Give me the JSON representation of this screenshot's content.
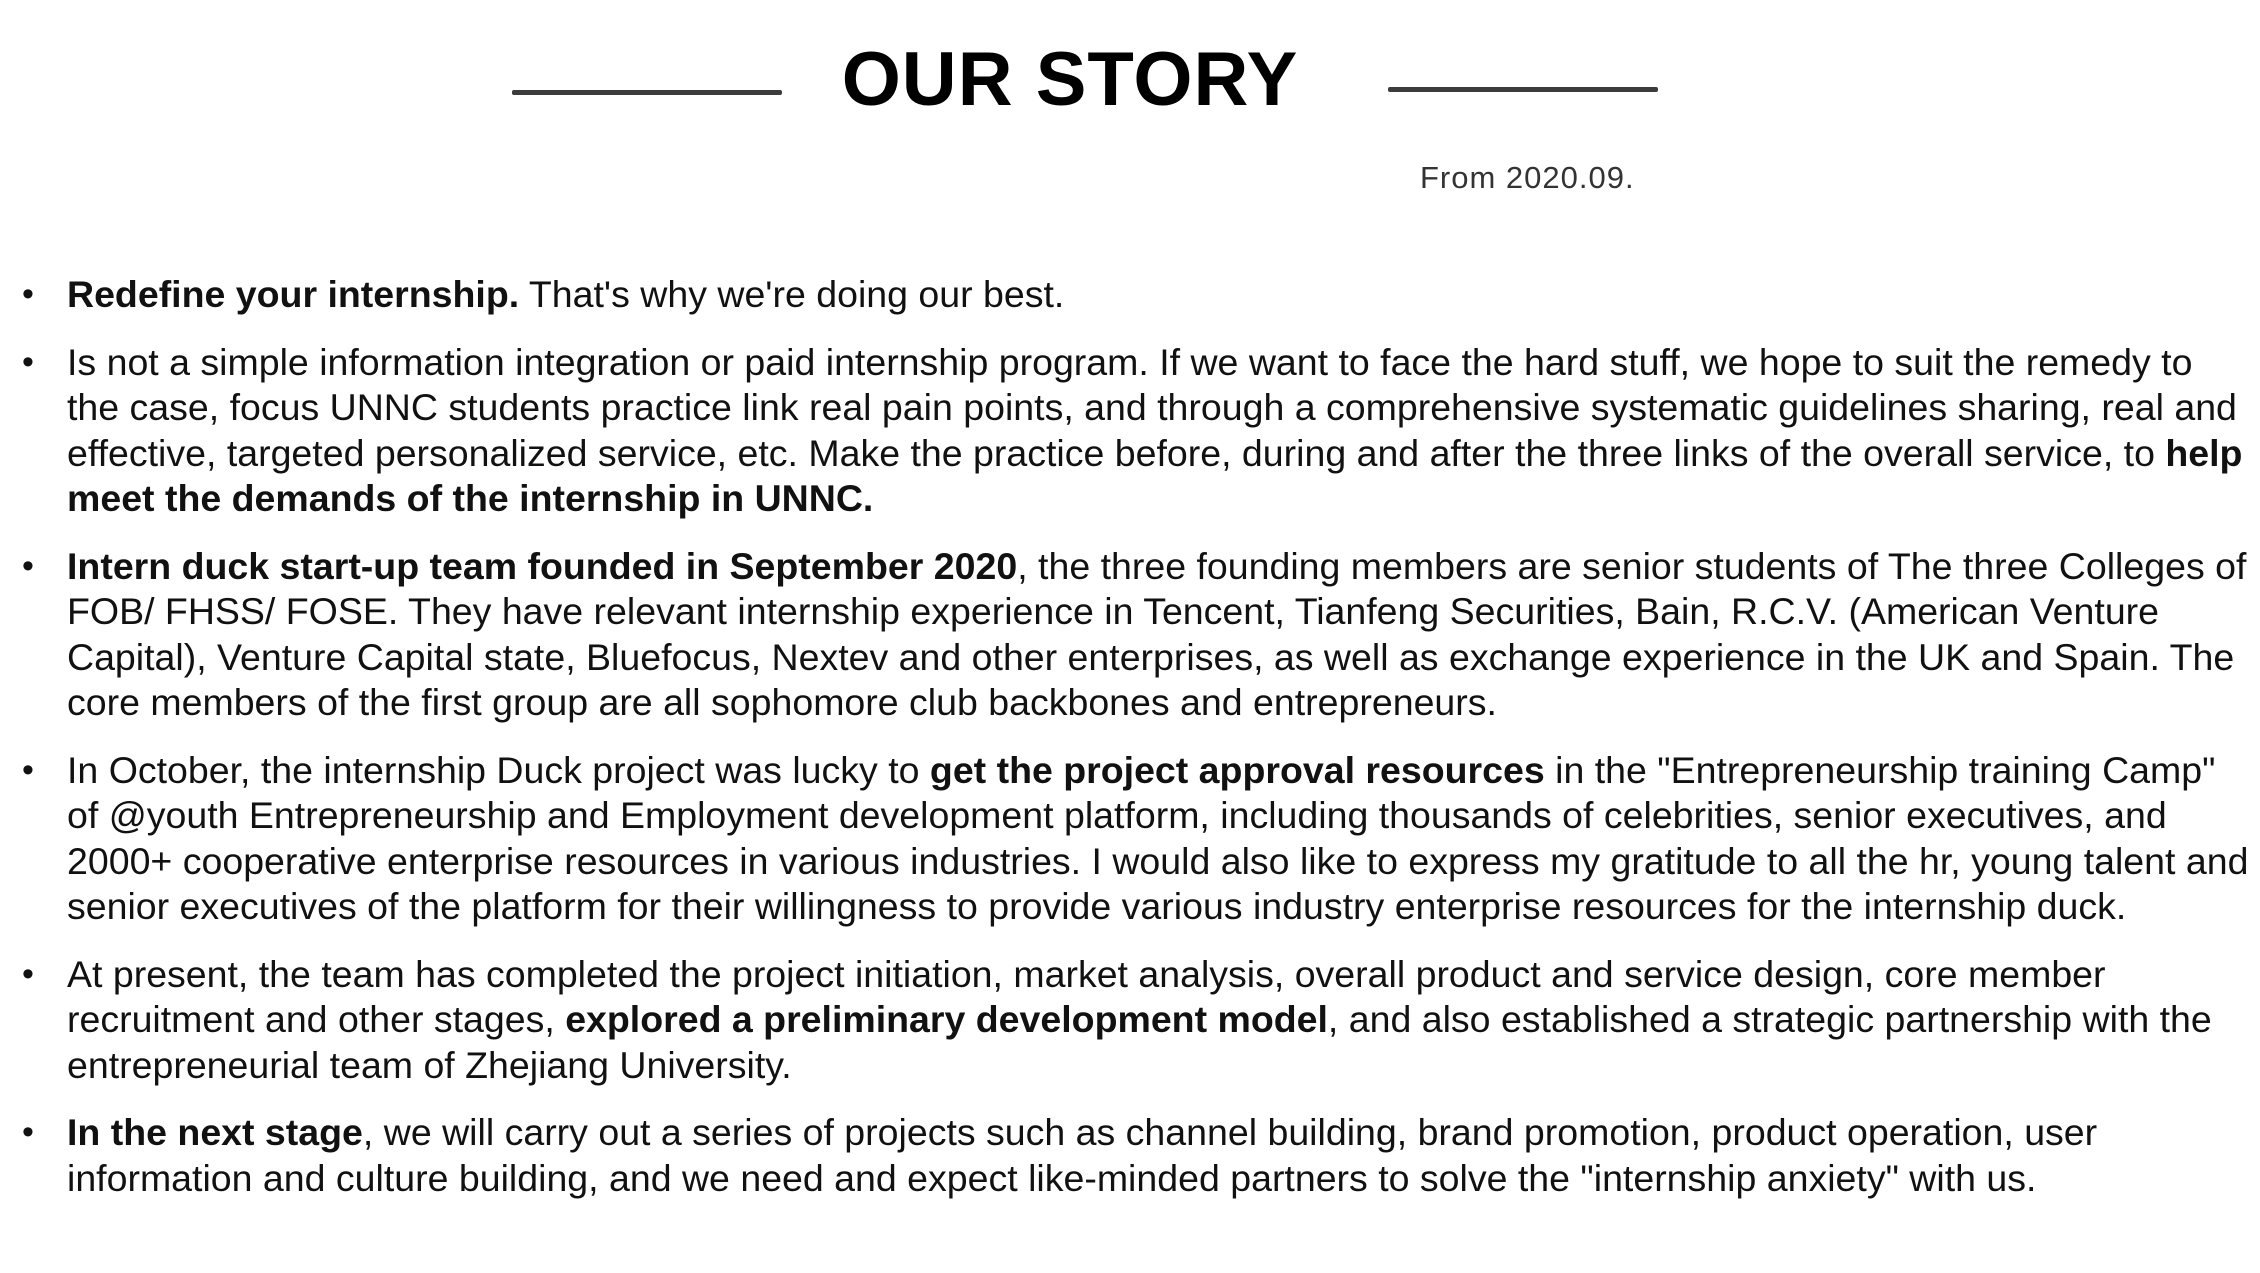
{
  "header": {
    "title": "OUR STORY",
    "subtitle": "From 2020.09."
  },
  "bullets": [
    {
      "segments": [
        {
          "text": "Redefine your internship.",
          "bold": true
        },
        {
          "text": " That's why we're doing our best.",
          "bold": false
        }
      ]
    },
    {
      "segments": [
        {
          "text": "Is not a simple information integration or paid internship program. If we want to face the hard stuff, we hope to suit the remedy to the case, focus UNNC students practice link real pain points, and through a comprehensive systematic guidelines sharing, real and effective, targeted personalized service, etc. Make the practice before, during and after the three links of the overall service, to ",
          "bold": false
        },
        {
          "text": "help meet the demands of the internship in UNNC.",
          "bold": true
        }
      ]
    },
    {
      "segments": [
        {
          "text": "Intern duck start-up team founded in September 2020",
          "bold": true
        },
        {
          "text": ", the three founding members are senior students of The three Colleges of FOB/ FHSS/ FOSE. They have relevant internship experience in Tencent, Tianfeng Securities, Bain, R.C.V. (American Venture Capital), Venture Capital state, Bluefocus, Nextev and other enterprises, as well as exchange experience in the UK and Spain. The core members of the first group are all sophomore club backbones and entrepreneurs.",
          "bold": false
        }
      ]
    },
    {
      "segments": [
        {
          "text": "In October, the internship Duck project was lucky to ",
          "bold": false
        },
        {
          "text": "get the project approval resources",
          "bold": true
        },
        {
          "text": " in the \"Entrepreneurship training Camp\" of @youth Entrepreneurship and Employment development platform, including thousands of celebrities, senior executives, and 2000+ cooperative enterprise resources in various industries. I would also like to express my gratitude to all the hr, young talent and senior executives of the platform for their willingness to provide various industry enterprise resources for the internship duck.",
          "bold": false
        }
      ]
    },
    {
      "segments": [
        {
          "text": "At present, the team has completed the project initiation, market analysis, overall product and service design, core member recruitment and other stages, ",
          "bold": false
        },
        {
          "text": "explored a preliminary development model",
          "bold": true
        },
        {
          "text": ", and also established a strategic partnership with the entrepreneurial team of Zhejiang University.",
          "bold": false
        }
      ]
    },
    {
      "segments": [
        {
          "text": "In the next stage",
          "bold": true
        },
        {
          "text": ", we will carry out a series of projects such as channel building, brand promotion, product operation, user information and culture building, and we need and expect like-minded partners to solve the \"internship anxiety\" with us.",
          "bold": false
        }
      ]
    }
  ]
}
